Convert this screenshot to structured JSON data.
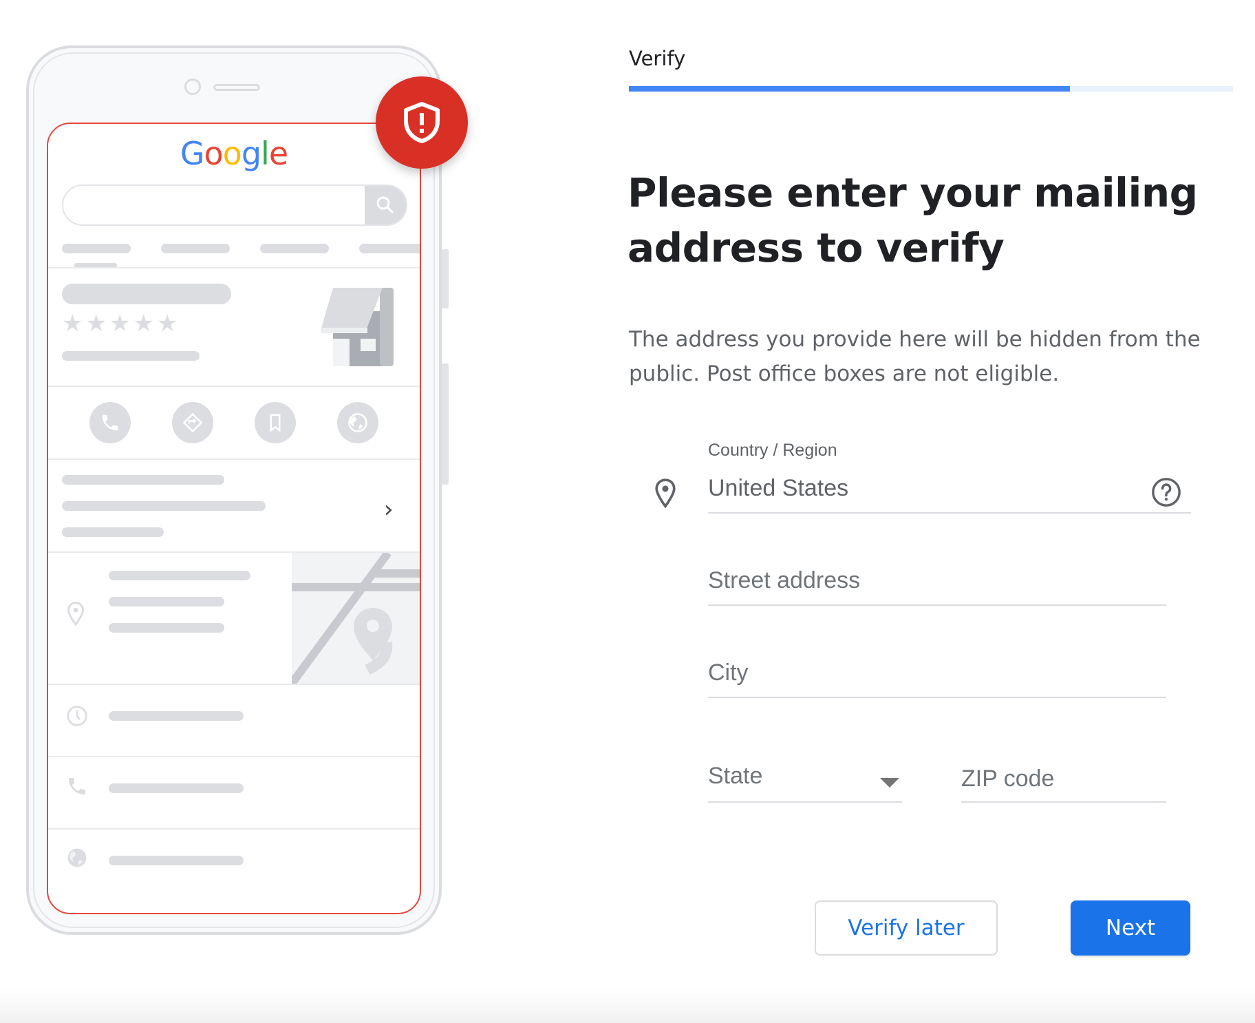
{
  "illustration": {
    "logo_letters": [
      {
        "char": "G",
        "color": "#4285f4"
      },
      {
        "char": "o",
        "color": "#ea4335"
      },
      {
        "char": "o",
        "color": "#fbbc05"
      },
      {
        "char": "g",
        "color": "#4285f4"
      },
      {
        "char": "l",
        "color": "#34a853"
      },
      {
        "char": "e",
        "color": "#ea4335"
      }
    ],
    "rating_stars": "★★★★★",
    "chevron": "›",
    "badge_icon": "shield-alert-icon",
    "badge_color": "#d93025",
    "action_icons": [
      "phone-icon",
      "directions-icon",
      "bookmark-icon",
      "globe-icon"
    ],
    "info_row_icons": [
      "clock-icon",
      "phone-icon",
      "globe-icon"
    ]
  },
  "step": {
    "title": "Verify",
    "progress_percent": 73
  },
  "heading": "Please enter your mailing address to verify",
  "description": "The address you provide here will be hidden from the public. Post office boxes are not eligible.",
  "form": {
    "country": {
      "label": "Country / Region",
      "value": "United States",
      "icon": "location-pin-icon",
      "help_icon": "help-circle-icon"
    },
    "street": {
      "placeholder": "Street address",
      "value": ""
    },
    "city": {
      "placeholder": "City",
      "value": ""
    },
    "state": {
      "placeholder": "State",
      "selected": ""
    },
    "zip": {
      "placeholder": "ZIP code",
      "value": ""
    }
  },
  "buttons": {
    "secondary": "Verify later",
    "primary": "Next"
  },
  "colors": {
    "accent": "#1a73e8",
    "progress": "#4285f4",
    "progress_track": "#e8f0fe",
    "alert_red": "#d93025"
  }
}
